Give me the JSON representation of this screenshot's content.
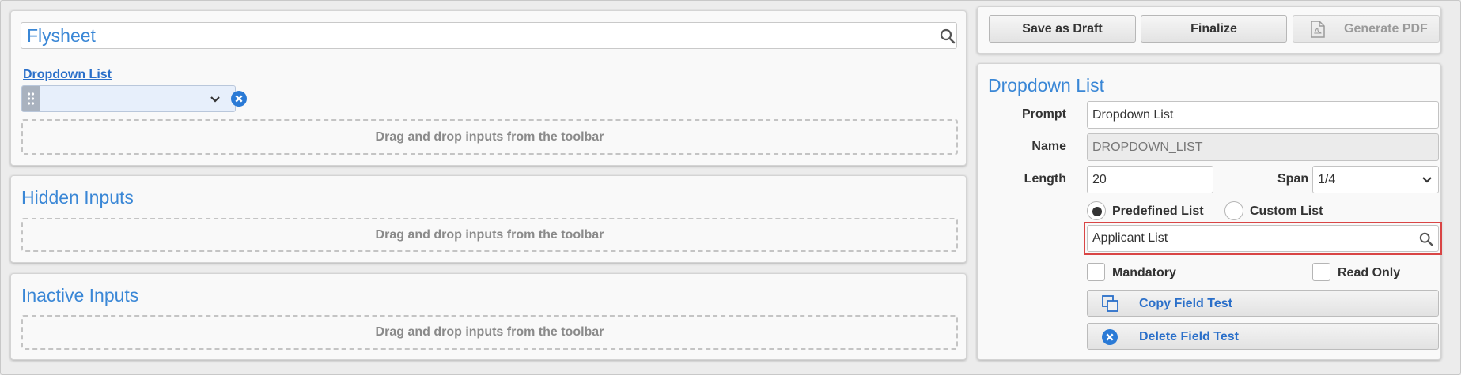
{
  "left": {
    "flysheet": {
      "title": "Flysheet",
      "field_link": "Dropdown List",
      "dropzone": "Drag and drop inputs from the toolbar"
    },
    "hidden": {
      "title": "Hidden Inputs",
      "dropzone": "Drag and drop inputs from the toolbar"
    },
    "inactive": {
      "title": "Inactive Inputs",
      "dropzone": "Drag and drop inputs from the toolbar"
    }
  },
  "toolbar": {
    "save_draft": "Save as Draft",
    "finalize": "Finalize",
    "generate_pdf": "Generate PDF"
  },
  "properties": {
    "title": "Dropdown List",
    "prompt_label": "Prompt",
    "prompt_value": "Dropdown List",
    "name_label": "Name",
    "name_value": "DROPDOWN_LIST",
    "length_label": "Length",
    "length_value": "20",
    "span_label": "Span",
    "span_value": "1/4",
    "predefined_label": "Predefined List",
    "custom_label": "Custom List",
    "list_value": "Applicant List",
    "mandatory_label": "Mandatory",
    "readonly_label": "Read Only",
    "copy_label": "Copy Field Test",
    "delete_label": "Delete Field Test"
  },
  "colors": {
    "accent": "#3a87d6",
    "link": "#2a6fc9",
    "highlight": "#d94545"
  }
}
